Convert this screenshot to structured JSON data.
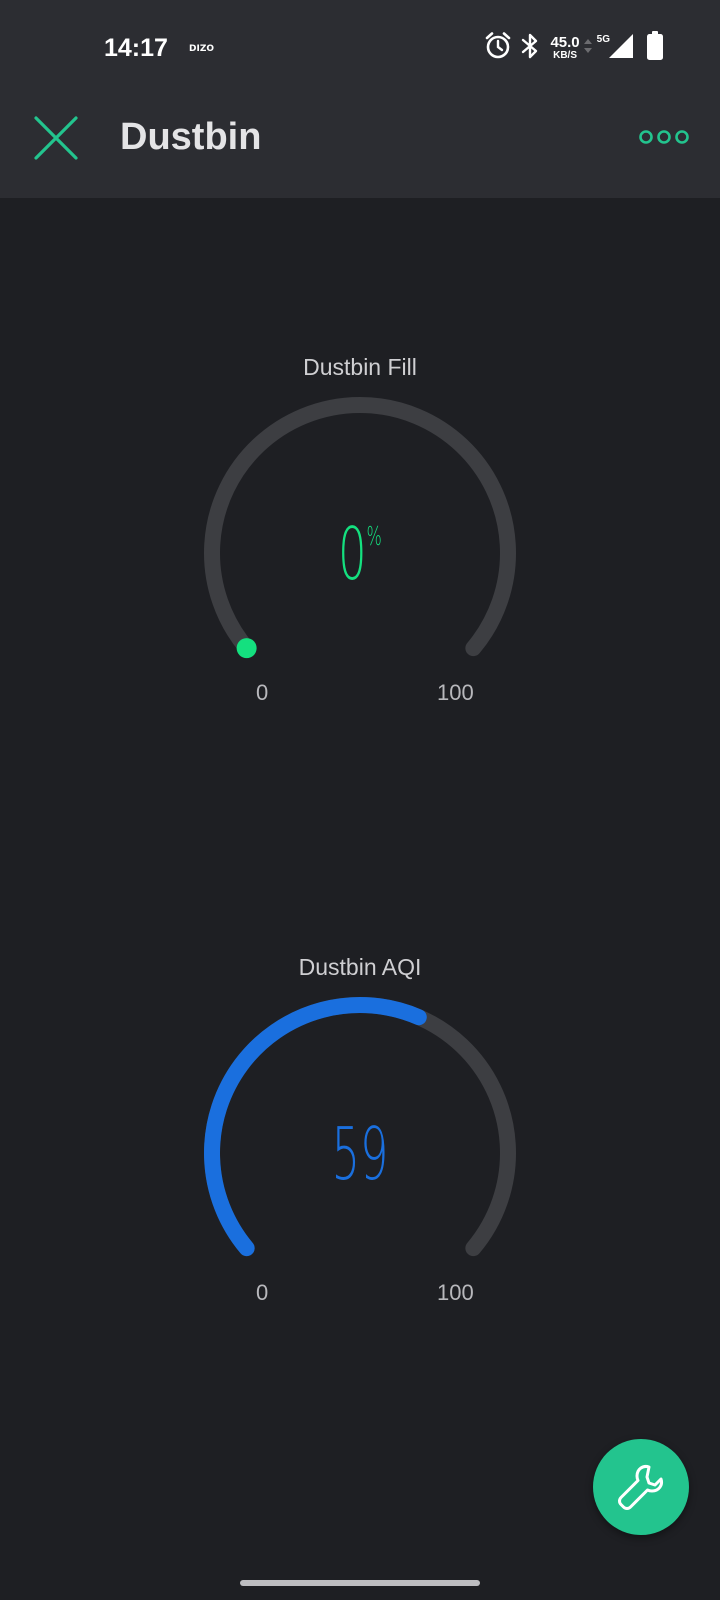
{
  "status_bar": {
    "time": "14:17",
    "carrier": "DIZO",
    "net_speed_value": "45.0",
    "net_speed_unit": "KB/S",
    "network_type": "5G",
    "icons": [
      "alarm-icon",
      "bluetooth-icon",
      "signal-icon",
      "battery-icon"
    ]
  },
  "header": {
    "title": "Dustbin",
    "close_icon": "close-icon",
    "more_icon": "more-icon",
    "accent_color": "#23c48e"
  },
  "gauges": [
    {
      "title": "Dustbin Fill",
      "value": 0,
      "display_value": "0",
      "suffix": "%",
      "min": 0,
      "max": 100,
      "min_label": "0",
      "max_label": "100",
      "color": "#14e07f"
    },
    {
      "title": "Dustbin AQI",
      "value": 59,
      "display_value": "59",
      "suffix": "",
      "min": 0,
      "max": 100,
      "min_label": "0",
      "max_label": "100",
      "color": "#1a6fde"
    }
  ],
  "fab": {
    "icon": "wrench-icon",
    "color": "#23c48e"
  }
}
